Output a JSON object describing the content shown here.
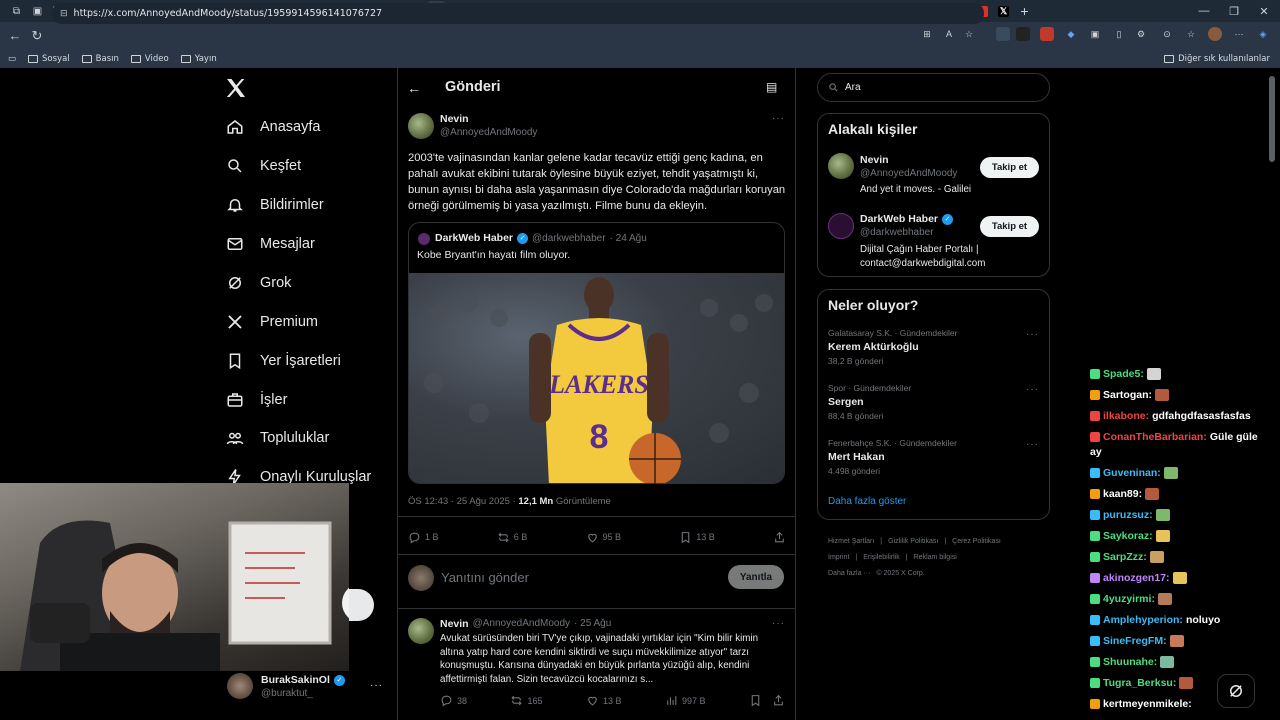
{
  "browser": {
    "url": "https://x.com/AnnoyedAndMoody/status/1959914596141076727",
    "bookmarks": [
      "Sosyal",
      "Basın",
      "Video",
      "Yayın"
    ],
    "bookmarks_right": "Diğer sık kullanılanlar"
  },
  "sidebar": {
    "items": [
      {
        "label": "Anasayfa",
        "icon": "home-icon"
      },
      {
        "label": "Keşfet",
        "icon": "search-icon"
      },
      {
        "label": "Bildirimler",
        "icon": "bell-icon"
      },
      {
        "label": "Mesajlar",
        "icon": "mail-icon"
      },
      {
        "label": "Grok",
        "icon": "grok-icon"
      },
      {
        "label": "Premium",
        "icon": "x-icon"
      },
      {
        "label": "Yer İşaretleri",
        "icon": "bookmark-icon"
      },
      {
        "label": "İşler",
        "icon": "briefcase-icon"
      },
      {
        "label": "Topluluklar",
        "icon": "people-icon"
      },
      {
        "label": "Onaylı Kuruluşlar",
        "icon": "lightning-icon"
      }
    ],
    "account": {
      "name": "BurakSakinOl",
      "handle": "@buraktut_"
    }
  },
  "main": {
    "header_title": "Gönderi",
    "tweet": {
      "name": "Nevin",
      "handle": "@AnnoyedAndMoody",
      "text": "2003'te vajinasından kanlar gelene kadar tecavüz ettiği genç kadına, en pahalı avukat ekibini tutarak öylesine büyük eziyet, tehdit yaşatmıştı ki, bunun aynısı bi daha asla yaşanmasın diye Colorado'da mağdurları koruyan örneği görülmemiş bi yasa yazılmıştı. Filme bunu da ekleyin.",
      "quote": {
        "name": "DarkWeb Haber",
        "handle": "@darkwebhaber",
        "date": "· 24 Ağu",
        "text": "Kobe Bryant'ın hayatı film oluyor."
      },
      "time": "ÖS 12:43 · 25 Ağu 2025 · ",
      "views": "12,1 Mn",
      "views_label": " Görüntüleme",
      "stats": {
        "replies": "1 B",
        "reposts": "6 B",
        "likes": "95 B",
        "bookmarks": "13 B"
      }
    },
    "reply_placeholder": "Yanıtını gönder",
    "reply_button": "Yanıtla",
    "reply": {
      "name": "Nevin",
      "handle": "@AnnoyedAndMoody",
      "date": "· 25 Ağu",
      "text": "Avukat sürüsünden biri TV'ye çıkıp, vajinadaki yırtıklar için \"Kim bilir kimin altına yatıp hard core kendini siktirdi ve suçu müvekkilimize atıyor\" tarzı konuşmuştu. Karısına dünyadaki en büyük pırlanta yüzüğü alıp, kendini affettirmişti falan. Sizin tecavüzcü kocalarınızı s...",
      "stats": {
        "replies": "38",
        "reposts": "165",
        "likes": "13 B",
        "views": "997 B"
      }
    }
  },
  "right": {
    "search_placeholder": "Ara",
    "people_title": "Alakalı kişiler",
    "people": [
      {
        "name": "Nevin",
        "handle": "@AnnoyedAndMoody",
        "bio": "And yet it moves. - Galilei",
        "button": "Takip et"
      },
      {
        "name": "DarkWeb Haber",
        "handle": "@darkwebhaber",
        "bio": "Dijital Çağın Haber Portalı | contact@darkwebdigital.com",
        "button": "Takip et"
      }
    ],
    "trends_title": "Neler oluyor?",
    "trends": [
      {
        "category": "Galatasaray S.K. · Gündemdekiler",
        "name": "Kerem Aktürkoğlu",
        "count": "38,2 B gönderi"
      },
      {
        "category": "Spor · Gündemdekiler",
        "name": "Sergen",
        "count": "88,4 B gönderi"
      },
      {
        "category": "Fenerbahçe S.K. · Gündemdekiler",
        "name": "Mert Hakan",
        "count": "4.498 gönderi"
      }
    ],
    "show_more": "Daha fazla göster",
    "footer": [
      "Hizmet Şartları",
      "Gizlilik Politikası",
      "Çerez Politikası",
      "Imprint",
      "Erişilebilirlik",
      "Reklam bilgisi",
      "Daha fazla ···",
      "© 2025 X Corp."
    ]
  },
  "chat": [
    {
      "user": "Spade5:",
      "color": "#4ade80",
      "msg": ""
    },
    {
      "user": "Sartogan:",
      "color": "#ffffff",
      "msg": ""
    },
    {
      "user": "ilkabone:",
      "color": "#ef4444",
      "msg": "gdfahgdfasasfasfas"
    },
    {
      "user": "ConanTheBarbarian:",
      "color": "#ef4444",
      "msg": "Güle güle"
    },
    {
      "user": "",
      "color": "#ffffff",
      "msg": "ay"
    },
    {
      "user": "Guveninan:",
      "color": "#38bdf8",
      "msg": ""
    },
    {
      "user": "kaan89:",
      "color": "#ffffff",
      "msg": ""
    },
    {
      "user": "puruzsuz:",
      "color": "#38bdf8",
      "msg": ""
    },
    {
      "user": "Saykoraz:",
      "color": "#4ade80",
      "msg": ""
    },
    {
      "user": "SarpZzz:",
      "color": "#4ade80",
      "msg": ""
    },
    {
      "user": "akinozgen17:",
      "color": "#c084fc",
      "msg": ""
    },
    {
      "user": "4yuzyirmi:",
      "color": "#4ade80",
      "msg": ""
    },
    {
      "user": "Amplehyperion:",
      "color": "#38bdf8",
      "msg": "noluyo"
    },
    {
      "user": "SineFregFM:",
      "color": "#38bdf8",
      "msg": ""
    },
    {
      "user": "Shuunahe:",
      "color": "#4ade80",
      "msg": ""
    },
    {
      "user": "Tugra_Berksu:",
      "color": "#4ade80",
      "msg": ""
    },
    {
      "user": "kertmeyenmikele:",
      "color": "#ffffff",
      "msg": ""
    }
  ],
  "colors": {
    "accent": "#1d9bf0",
    "background": "#000000",
    "border": "#2f3336",
    "muted": "#71767b"
  }
}
